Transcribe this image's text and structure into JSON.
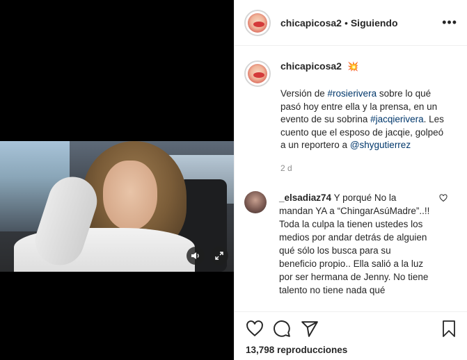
{
  "post": {
    "username": "chicapicosa2",
    "separator": "•",
    "follow_status": "Siguiendo",
    "more_label": "•••"
  },
  "caption": {
    "username": "chicapicosa2",
    "emoji": "💥",
    "text_before": "Versión de ",
    "tag1": "#rosierivera",
    "text_mid1": " sobre lo qué pasó hoy entre ella y la prensa, en un evento de su sobrina ",
    "tag2": "#jacqierivera",
    "text_mid2": ". Les cuento que el esposo de jacqie, golpeó a un reportero a ",
    "mention": "@shygutierrez",
    "age": "2 d"
  },
  "comment": {
    "username": "_elsadiaz74",
    "text": " Y porqué No la mandan YA a “ChingarAsúMadre”..!! Toda la culpa la tienen ustedes los medios por andar detrás de alguien qué sólo los busca para su beneficio propio.. Ella salió a la luz por ser hermana de Jenny. No tiene talento no tiene nada qué"
  },
  "stats": {
    "views": "13,798 reproducciones"
  },
  "icons": {
    "sound": "speaker-icon",
    "expand": "expand-icon",
    "like": "heart-icon",
    "comment": "comment-icon",
    "share": "send-icon",
    "save": "bookmark-icon",
    "comment_like": "heart-icon"
  },
  "colors": {
    "text": "#262626",
    "muted": "#8e8e8e",
    "link": "#00376b",
    "divider": "#efefef"
  }
}
